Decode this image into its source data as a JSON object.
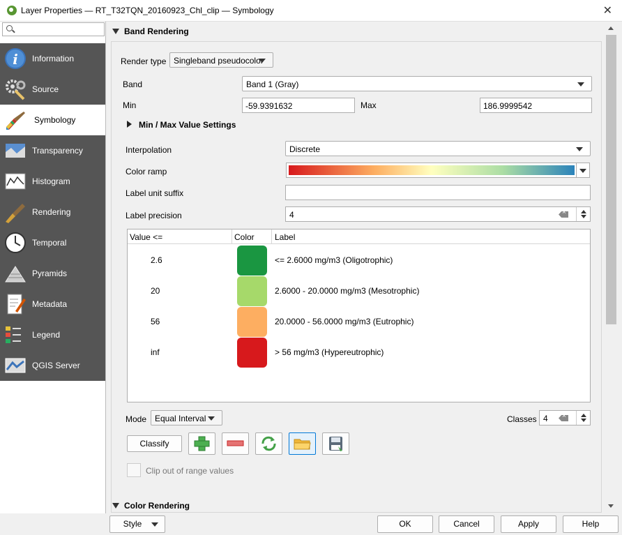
{
  "window": {
    "title": "Layer Properties — RT_T32TQN_20160923_Chl_clip — Symbology",
    "close_glyph": "✕"
  },
  "sidebar": {
    "search_placeholder": "",
    "items": [
      {
        "label": "Information",
        "icon": "information-icon",
        "active": false
      },
      {
        "label": "Source",
        "icon": "source-icon",
        "active": false
      },
      {
        "label": "Symbology",
        "icon": "symbology-icon",
        "active": true
      },
      {
        "label": "Transparency",
        "icon": "transparency-icon",
        "active": false
      },
      {
        "label": "Histogram",
        "icon": "histogram-icon",
        "active": false
      },
      {
        "label": "Rendering",
        "icon": "rendering-icon",
        "active": false
      },
      {
        "label": "Temporal",
        "icon": "temporal-icon",
        "active": false
      },
      {
        "label": "Pyramids",
        "icon": "pyramids-icon",
        "active": false
      },
      {
        "label": "Metadata",
        "icon": "metadata-icon",
        "active": false
      },
      {
        "label": "Legend",
        "icon": "legend-icon",
        "active": false
      },
      {
        "label": "QGIS Server",
        "icon": "qgis-server-icon",
        "active": false
      }
    ]
  },
  "band_rendering": {
    "section_title": "Band Rendering",
    "render_type_label": "Render type",
    "render_type_value": "Singleband pseudocolor",
    "band_label": "Band",
    "band_value": "Band 1 (Gray)",
    "min_label": "Min",
    "min_value": "-59.9391632",
    "max_label": "Max",
    "max_value": "186.9999542",
    "minmax_settings_label": "Min / Max Value Settings",
    "interpolation_label": "Interpolation",
    "interpolation_value": "Discrete",
    "color_ramp_label": "Color ramp",
    "label_unit_suffix_label": "Label unit suffix",
    "label_unit_suffix_value": "",
    "label_precision_label": "Label precision",
    "label_precision_value": "4",
    "table": {
      "headers": [
        "Value <=",
        "Color",
        "Label"
      ],
      "rows": [
        {
          "value": "2.6",
          "color": "#1a9641",
          "label": "<= 2.6000 mg/m3 (Oligotrophic)"
        },
        {
          "value": "20",
          "color": "#a6d96a",
          "label": "2.6000 - 20.0000 mg/m3 (Mesotrophic)"
        },
        {
          "value": "56",
          "color": "#fdae61",
          "label": "20.0000 - 56.0000 mg/m3 (Eutrophic)"
        },
        {
          "value": "inf",
          "color": "#d7191c",
          "label": "> 56 mg/m3 (Hypereutrophic)"
        }
      ]
    },
    "mode_label": "Mode",
    "mode_value": "Equal Interval",
    "classes_label": "Classes",
    "classes_value": "4",
    "classify_label": "Classify",
    "clip_label": "Clip out of range values"
  },
  "color_rendering": {
    "section_title": "Color Rendering"
  },
  "footer": {
    "style": "Style",
    "ok": "OK",
    "cancel": "Cancel",
    "apply": "Apply",
    "help": "Help"
  }
}
